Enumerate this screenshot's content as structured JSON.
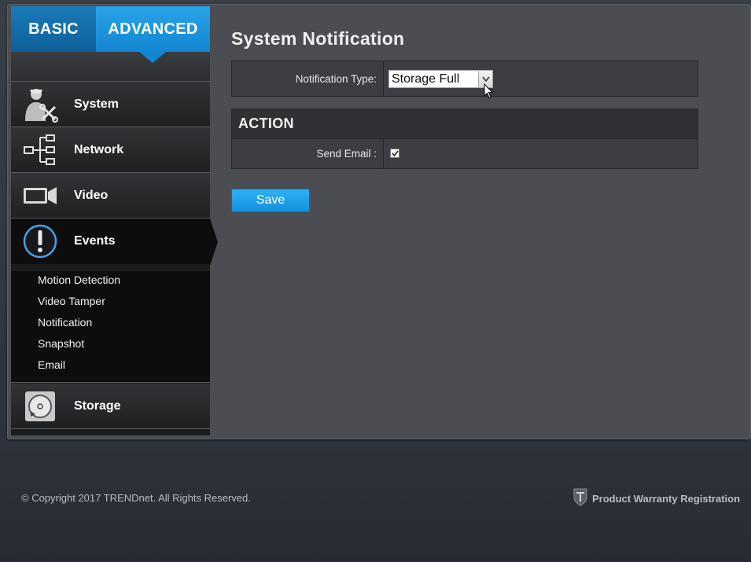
{
  "mode_tabs": {
    "basic": "BASIC",
    "advanced": "ADVANCED"
  },
  "nav": {
    "system": "System",
    "network": "Network",
    "video": "Video",
    "events": "Events",
    "storage": "Storage"
  },
  "events_submenu": [
    "Motion Detection",
    "Video Tamper",
    "Notification",
    "Snapshot",
    "Email"
  ],
  "page": {
    "title": "System Notification",
    "notification_type_label": "Notification Type:",
    "notification_type_value": "Storage Full",
    "action_header": "ACTION",
    "send_email_label": "Send Email :",
    "send_email_checked": true,
    "save_label": "Save"
  },
  "footer": {
    "copyright": "© Copyright 2017 TRENDnet. All Rights Reserved.",
    "warranty": "Product Warranty Registration"
  },
  "colors": {
    "accent": "#1691df",
    "active_tab": "#2aa4e8"
  },
  "icons": [
    "system-user-tools-icon",
    "network-tree-icon",
    "video-camera-icon",
    "events-alert-icon",
    "storage-disk-icon",
    "dropdown-icon",
    "trendnet-shield-icon"
  ]
}
